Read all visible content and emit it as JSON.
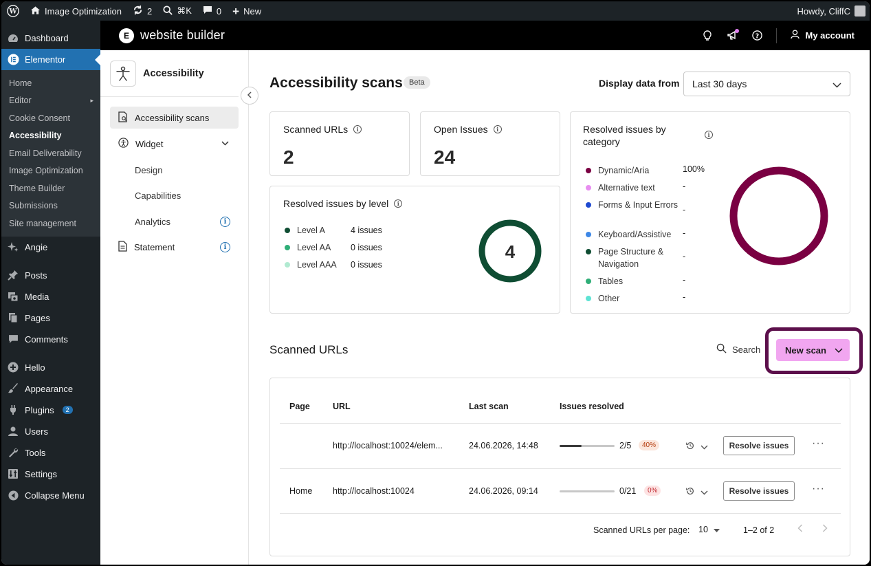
{
  "adminbar": {
    "site_name": "Image Optimization",
    "updates_count": "2",
    "search_shortcut": "⌘K",
    "comments_count": "0",
    "new_label": "New",
    "howdy": "Howdy, CliffC"
  },
  "wp_menu": {
    "dashboard": "Dashboard",
    "elementor": "Elementor",
    "submenu": [
      "Home",
      "Editor",
      "Cookie Consent",
      "Accessibility",
      "Email Deliverability",
      "Image Optimization",
      "Theme Builder",
      "Submissions",
      "Site management"
    ],
    "angie": "Angie",
    "posts": "Posts",
    "media": "Media",
    "pages": "Pages",
    "comments": "Comments",
    "hello": "Hello",
    "appearance": "Appearance",
    "plugins": "Plugins",
    "plugins_badge": "2",
    "users": "Users",
    "tools": "Tools",
    "settings": "Settings",
    "collapse": "Collapse Menu"
  },
  "header": {
    "logo_letter": "E",
    "title": "website builder",
    "my_account": "My account"
  },
  "panel": {
    "title": "Accessibility",
    "nav": {
      "scans": "Accessibility scans",
      "widget": "Widget",
      "design": "Design",
      "capabilities": "Capabilities",
      "analytics": "Analytics",
      "statement": "Statement"
    }
  },
  "main": {
    "title": "Accessibility scans",
    "beta": "Beta",
    "display_label": "Display data from",
    "display_value": "Last 30 days",
    "scanned_urls": {
      "label": "Scanned URLs",
      "value": "2"
    },
    "open_issues": {
      "label": "Open Issues",
      "value": "24"
    },
    "by_level": {
      "title": "Resolved issues by level",
      "center": "4",
      "items": [
        {
          "label": "Level A",
          "value": "4 issues",
          "color": "#0f4d33"
        },
        {
          "label": "Level AA",
          "value": "0 issues",
          "color": "#2fae77"
        },
        {
          "label": "Level AAA",
          "value": "0 issues",
          "color": "#b1ead1"
        }
      ]
    },
    "by_category": {
      "title": "Resolved issues by category",
      "items": [
        {
          "label": "Dynamic/Aria",
          "value": "100%",
          "color": "#7a0042"
        },
        {
          "label": "Alternative text",
          "value": "-",
          "color": "#e88ef0"
        },
        {
          "label": "Forms & Input Errors",
          "value": "-",
          "color": "#1f4ad1"
        },
        {
          "label": "Keyboard/Assistive",
          "value": "-",
          "color": "#3d87e6"
        },
        {
          "label": "Page Structure & Navigation",
          "value": "-",
          "color": "#0f4d33"
        },
        {
          "label": "Tables",
          "value": "-",
          "color": "#2fae77"
        },
        {
          "label": "Other",
          "value": "-",
          "color": "#5ee3d4"
        }
      ]
    },
    "list_title": "Scanned URLs",
    "search_label": "Search",
    "new_scan": "New scan",
    "table": {
      "headers": [
        "Page",
        "URL",
        "Last scan",
        "Issues resolved"
      ],
      "rows": [
        {
          "page": "",
          "url": "http://localhost:10024/elem...",
          "last_scan": "24.06.2026, 14:48",
          "resolved": "2/5",
          "progress": 0.4,
          "pct": "40%",
          "action": "Resolve issues"
        },
        {
          "page": "Home",
          "url": "http://localhost:10024",
          "last_scan": "24.06.2026, 09:14",
          "resolved": "0/21",
          "progress": 0.0,
          "pct": "0%",
          "action": "Resolve issues"
        }
      ],
      "per_page_label": "Scanned URLs per page:",
      "per_page_value": "10",
      "range": "1–2 of 2"
    }
  }
}
